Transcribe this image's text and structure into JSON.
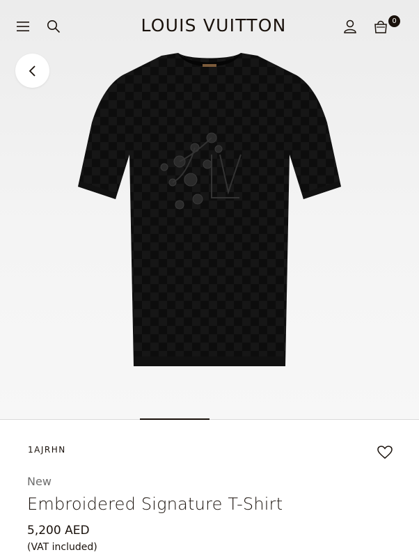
{
  "header": {
    "brand": "LOUIS VUITTON",
    "bag_count": "0",
    "icons": [
      "menu-icon",
      "search-icon",
      "account-icon",
      "shopping-bag-icon"
    ]
  },
  "gallery": {
    "back_icon": "chevron-left-icon",
    "image": "black t-shirt with damier pattern and floral embroidery",
    "active_slide": 2,
    "total_slides": 6
  },
  "product": {
    "sku": "1AJRHN",
    "badge": "New",
    "name": "Embroidered Signature T-Shirt",
    "price": "5,200 AED",
    "vat_note": "(VAT included)",
    "wishlist_icon": "heart-icon"
  },
  "colors": {
    "text": "#19110b",
    "muted": "#6d6d6d",
    "hero_bg": "#eeeeee"
  }
}
